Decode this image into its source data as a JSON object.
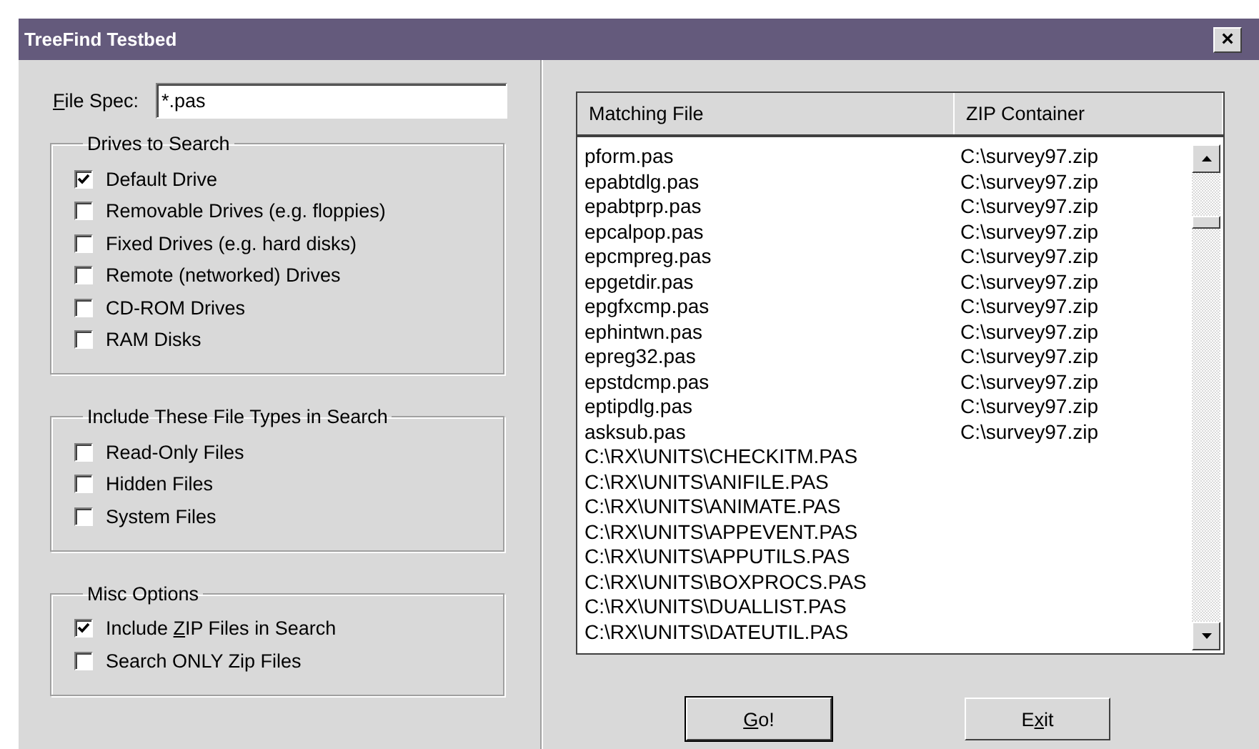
{
  "window": {
    "title": "TreeFind Testbed",
    "close_label": "×"
  },
  "file_spec": {
    "label": {
      "key": "F",
      "after": "ile Spec:"
    },
    "value": "*.pas"
  },
  "groups": [
    {
      "title": "Drives to Search",
      "options": [
        {
          "label": {
            "before": "Default Drive"
          },
          "checked": true
        },
        {
          "label": {
            "before": "Removable Drives (e.g. floppies)"
          },
          "checked": false
        },
        {
          "label": {
            "before": "Fixed Drives (e.g. hard disks)"
          },
          "checked": false
        },
        {
          "label": {
            "before": "Remote (networked) Drives"
          },
          "checked": false
        },
        {
          "label": {
            "before": "CD-ROM Drives"
          },
          "checked": false
        },
        {
          "label": {
            "before": "RAM Disks"
          },
          "checked": false
        }
      ]
    },
    {
      "title": "Include These File Types in Search",
      "options": [
        {
          "label": {
            "before": "Read-Only Files"
          },
          "checked": false
        },
        {
          "label": {
            "before": "Hidden Files"
          },
          "checked": false
        },
        {
          "label": {
            "before": "System Files"
          },
          "checked": false
        }
      ]
    },
    {
      "title": "Misc Options",
      "options": [
        {
          "label": {
            "before": "Include ",
            "key": "Z",
            "after": "IP Files in Search"
          },
          "checked": true
        },
        {
          "label": {
            "before": "Search ONLY Zip Files"
          },
          "checked": false
        }
      ]
    }
  ],
  "table": {
    "columns": [
      "Matching File",
      "ZIP Container"
    ],
    "rows": [
      [
        "pform.pas",
        "C:\\survey97.zip"
      ],
      [
        "epabtdlg.pas",
        "C:\\survey97.zip"
      ],
      [
        "epabtprp.pas",
        "C:\\survey97.zip"
      ],
      [
        "epcalpop.pas",
        "C:\\survey97.zip"
      ],
      [
        "epcmpreg.pas",
        "C:\\survey97.zip"
      ],
      [
        "epgetdir.pas",
        "C:\\survey97.zip"
      ],
      [
        "epgfxcmp.pas",
        "C:\\survey97.zip"
      ],
      [
        "ephintwn.pas",
        "C:\\survey97.zip"
      ],
      [
        "epreg32.pas",
        "C:\\survey97.zip"
      ],
      [
        "epstdcmp.pas",
        "C:\\survey97.zip"
      ],
      [
        "eptipdlg.pas",
        "C:\\survey97.zip"
      ],
      [
        "asksub.pas",
        "C:\\survey97.zip"
      ],
      [
        "C:\\RX\\UNITS\\CHECKITM.PAS"
      ],
      [
        "C:\\RX\\UNITS\\ANIFILE.PAS"
      ],
      [
        "C:\\RX\\UNITS\\ANIMATE.PAS"
      ],
      [
        "C:\\RX\\UNITS\\APPEVENT.PAS"
      ],
      [
        "C:\\RX\\UNITS\\APPUTILS.PAS"
      ],
      [
        "C:\\RX\\UNITS\\BOXPROCS.PAS"
      ],
      [
        "C:\\RX\\UNITS\\DUALLIST.PAS"
      ],
      [
        "C:\\RX\\UNITS\\DATEUTIL.PAS"
      ]
    ]
  },
  "buttons": [
    {
      "label": {
        "key": "G",
        "after": "o!"
      },
      "default": true
    },
    {
      "label": {
        "before": "E",
        "key": "x",
        "after": "it"
      },
      "default": false
    }
  ]
}
